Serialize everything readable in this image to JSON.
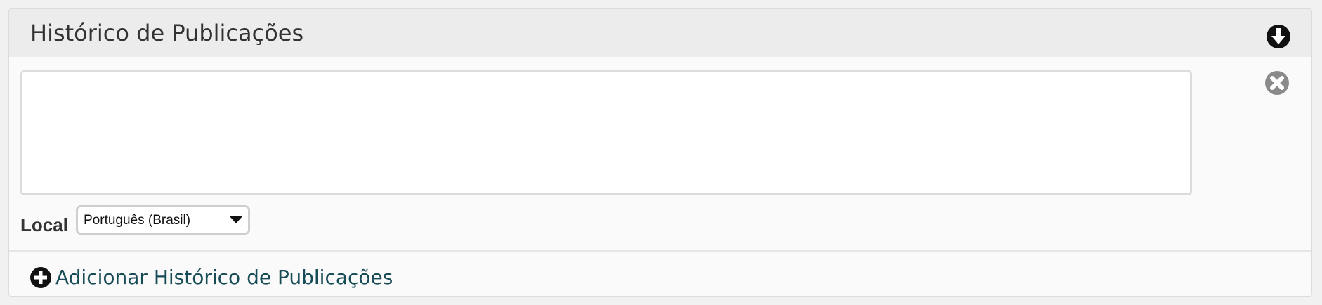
{
  "panel": {
    "title": "Histórico de Publicações",
    "collapse_icon": "arrow-down-circle-icon",
    "remove_icon": "close-circle-icon",
    "textarea": {
      "value": "",
      "placeholder": ""
    },
    "locale": {
      "label": "Local",
      "selected": "Português (Brasil)"
    },
    "add_button": {
      "icon": "plus-circle-icon",
      "label": "Adicionar Histórico de Publicações"
    }
  },
  "colors": {
    "header_bg": "#ececec",
    "panel_bg": "#fafafa",
    "link": "#174b56",
    "icon_dark": "#111111",
    "icon_gray": "#8a8a8a"
  }
}
